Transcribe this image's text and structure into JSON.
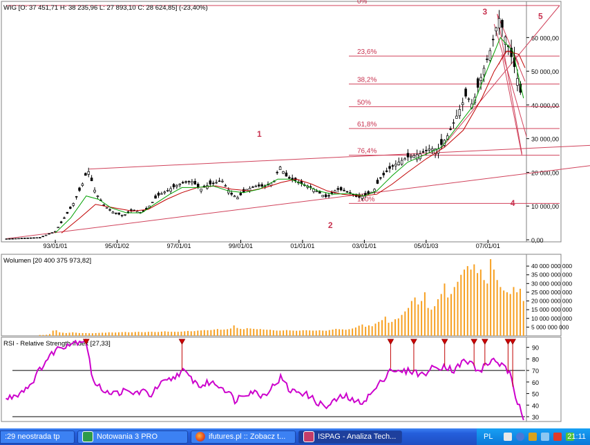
{
  "chart_data": [
    {
      "type": "candlestick",
      "title": "WIG [O: 37 451,71  H: 38 235,96  L: 27 893,10  C: 28 624,85] (-23,40%)",
      "x_ticks": [
        "93/01/01",
        "95/01/02",
        "97/01/01",
        "99/01/01",
        "01/01/01",
        "03/01/01",
        "05/01/03",
        "07/01/01"
      ],
      "x_range": [
        1991.3,
        2008.2
      ],
      "y_ticks": [
        "0,00",
        "10 000,00",
        "20 000,00",
        "30 000,00",
        "40 000,00",
        "50 000,00",
        "60 000,00"
      ],
      "y_range": [
        0,
        69500
      ],
      "series_price": [
        [
          1991.4,
          300
        ],
        [
          1992.5,
          700
        ],
        [
          1993.0,
          2500
        ],
        [
          1993.3,
          6500
        ],
        [
          1993.6,
          11000
        ],
        [
          1993.9,
          17000
        ],
        [
          1994.05,
          21000
        ],
        [
          1994.3,
          14000
        ],
        [
          1994.6,
          10000
        ],
        [
          1994.9,
          8000
        ],
        [
          1995.2,
          7200
        ],
        [
          1995.5,
          8800
        ],
        [
          1995.8,
          8000
        ],
        [
          1996.0,
          9500
        ],
        [
          1996.3,
          13000
        ],
        [
          1996.7,
          15000
        ],
        [
          1997.0,
          16500
        ],
        [
          1997.4,
          17500
        ],
        [
          1997.7,
          15000
        ],
        [
          1998.0,
          16500
        ],
        [
          1998.4,
          17500
        ],
        [
          1998.7,
          13500
        ],
        [
          1998.9,
          12500
        ],
        [
          1999.2,
          15000
        ],
        [
          1999.5,
          16000
        ],
        [
          1999.8,
          15800
        ],
        [
          2000.1,
          17500
        ],
        [
          2000.25,
          22000
        ],
        [
          2000.5,
          18500
        ],
        [
          2000.8,
          17500
        ],
        [
          2001.0,
          16500
        ],
        [
          2001.3,
          15500
        ],
        [
          2001.6,
          13500
        ],
        [
          2001.8,
          12500
        ],
        [
          2002.1,
          15000
        ],
        [
          2002.4,
          14500
        ],
        [
          2002.8,
          12500
        ],
        [
          2003.1,
          13500
        ],
        [
          2003.3,
          14500
        ],
        [
          2003.5,
          18000
        ],
        [
          2003.8,
          21000
        ],
        [
          2004.1,
          23000
        ],
        [
          2004.4,
          24500
        ],
        [
          2004.8,
          25500
        ],
        [
          2005.1,
          27000
        ],
        [
          2005.4,
          27000
        ],
        [
          2005.7,
          31000
        ],
        [
          2006.0,
          37000
        ],
        [
          2006.3,
          43000
        ],
        [
          2006.5,
          40000
        ],
        [
          2006.8,
          49000
        ],
        [
          2007.1,
          57000
        ],
        [
          2007.35,
          66000
        ],
        [
          2007.5,
          62000
        ],
        [
          2007.7,
          56000
        ],
        [
          2007.9,
          50000
        ],
        [
          2008.05,
          44000
        ],
        [
          2008.15,
          28624
        ]
      ],
      "series_ma_green": [
        [
          1993.0,
          2000
        ],
        [
          1993.5,
          6500
        ],
        [
          1994.0,
          13000
        ],
        [
          1994.4,
          12000
        ],
        [
          1994.8,
          9500
        ],
        [
          1995.3,
          8000
        ],
        [
          1995.8,
          8000
        ],
        [
          1996.2,
          10500
        ],
        [
          1996.7,
          13500
        ],
        [
          1997.1,
          15500
        ],
        [
          1997.6,
          15500
        ],
        [
          1998.1,
          16000
        ],
        [
          1998.6,
          14500
        ],
        [
          1999.1,
          14000
        ],
        [
          1999.6,
          15000
        ],
        [
          2000.2,
          18000
        ],
        [
          2000.6,
          18000
        ],
        [
          2001.0,
          16500
        ],
        [
          2001.5,
          14500
        ],
        [
          2002.0,
          13500
        ],
        [
          2002.5,
          13800
        ],
        [
          2003.0,
          13000
        ],
        [
          2003.4,
          14500
        ],
        [
          2003.9,
          19000
        ],
        [
          2004.4,
          23000
        ],
        [
          2004.9,
          25000
        ],
        [
          2005.5,
          27500
        ],
        [
          2006.0,
          33500
        ],
        [
          2006.5,
          39500
        ],
        [
          2007.0,
          51000
        ],
        [
          2007.4,
          60000
        ],
        [
          2007.8,
          56000
        ],
        [
          2008.15,
          42000
        ]
      ],
      "series_ma_red": [
        [
          1993.2,
          2000
        ],
        [
          1993.8,
          6500
        ],
        [
          1994.3,
          10500
        ],
        [
          1994.9,
          9500
        ],
        [
          1995.5,
          8500
        ],
        [
          1996.0,
          9000
        ],
        [
          1996.6,
          12000
        ],
        [
          1997.1,
          14000
        ],
        [
          1997.6,
          15500
        ],
        [
          1998.2,
          16000
        ],
        [
          1998.7,
          15000
        ],
        [
          1999.3,
          14500
        ],
        [
          1999.8,
          15500
        ],
        [
          2000.3,
          17000
        ],
        [
          2000.8,
          18000
        ],
        [
          2001.3,
          16500
        ],
        [
          2001.8,
          14500
        ],
        [
          2002.3,
          13500
        ],
        [
          2002.9,
          13000
        ],
        [
          2003.4,
          13500
        ],
        [
          2003.9,
          16500
        ],
        [
          2004.4,
          20000
        ],
        [
          2005.0,
          24000
        ],
        [
          2005.6,
          27500
        ],
        [
          2006.2,
          32500
        ],
        [
          2006.8,
          42000
        ],
        [
          2007.2,
          50000
        ],
        [
          2007.6,
          56000
        ],
        [
          2008.0,
          55000
        ],
        [
          2008.2,
          51000
        ]
      ],
      "fibonacci_levels": [
        "0%",
        "23,6%",
        "38,2%",
        "50%",
        "61,8%",
        "76,4%",
        "100%"
      ],
      "fibonacci_values": [
        69500,
        54500,
        46200,
        39500,
        33000,
        25100,
        10800
      ],
      "wave_labels": [
        "1",
        "2",
        "3",
        "4",
        "5"
      ],
      "colors": {
        "price": "#000000",
        "ma_green": "#00a000",
        "ma_red": "#c00000",
        "lines": "#d0415a",
        "labels": "#c8324f"
      }
    },
    {
      "type": "bar",
      "title": "Wolumen [20 400 375 973,82]",
      "y_ticks": [
        "5 000 000 000",
        "10 000 000 000",
        "15 000 000 000",
        "20 000 000 000",
        "25 000 000 000",
        "30 000 000 000",
        "35 000 000 000",
        "40 000 000 000"
      ],
      "y_range": [
        0,
        44000000000
      ],
      "values_bn": [
        0.5,
        0.5,
        0.6,
        1.0,
        3.0,
        3.2,
        2.0,
        1.8,
        1.6,
        1.8,
        2.0,
        1.8,
        1.6,
        1.6,
        1.6,
        1.5,
        1.5,
        1.6,
        1.7,
        1.8,
        1.8,
        2.0,
        1.9,
        1.9,
        2.0,
        2.1,
        2.2,
        2.0,
        2.0,
        2.2,
        2.3,
        2.1,
        2.1,
        2.3,
        2.3,
        2.2,
        2.2,
        2.4,
        2.6,
        2.4,
        2.3,
        2.3,
        2.3,
        2.4,
        2.6,
        2.8,
        2.6,
        2.7,
        3.0,
        3.1,
        3.3,
        3.2,
        3.3,
        3.6,
        3.9,
        3.5,
        3.6,
        3.8,
        4.2,
        6.0,
        4.5,
        4.0,
        3.8,
        4.4,
        4.2,
        4.0,
        3.8,
        3.9,
        3.6,
        3.5,
        3.5,
        3.2,
        3.0,
        3.0,
        3.1,
        3.3,
        3.1,
        3.0,
        2.9,
        3.0,
        3.2,
        3.2,
        3.1,
        3.0,
        3.0,
        3.2,
        3.0,
        2.9,
        3.3,
        3.6,
        4.0,
        3.8,
        3.7,
        3.5,
        3.8,
        4.2,
        4.8,
        5.8,
        6.5,
        5.2,
        6.0,
        5.5,
        7.0,
        8.0,
        9.0,
        11.0,
        7.5,
        8.0,
        9.5,
        10.0,
        12.0,
        14.0,
        16.0,
        20.0,
        22.0,
        18.0,
        20.0,
        25.0,
        16.0,
        15.0,
        17.0,
        21.0,
        24.0,
        30.0,
        22.0,
        24.0,
        28.0,
        31.0,
        35.0,
        38.0,
        40.0,
        38.0,
        41.0,
        36.0,
        38.0,
        32.0,
        30.0,
        44.0,
        38.0,
        32.0,
        28.0,
        26.0,
        25.0,
        24.0,
        28.0,
        25.0,
        27.0,
        20.0
      ],
      "color": "#f7a021"
    },
    {
      "type": "line",
      "title": "RSI - Relative Strength Index [27,33]",
      "y_ticks": [
        "30",
        "40",
        "50",
        "60",
        "70",
        "80",
        "90"
      ],
      "y_range": [
        27,
        97
      ],
      "reference_levels": [
        70,
        30
      ],
      "series_rsi": [
        [
          1991.4,
          45
        ],
        [
          1991.8,
          50
        ],
        [
          1992.2,
          58
        ],
        [
          1992.6,
          75
        ],
        [
          1993.0,
          88
        ],
        [
          1993.4,
          93
        ],
        [
          1993.7,
          95
        ],
        [
          1994.0,
          97
        ],
        [
          1994.15,
          70
        ],
        [
          1994.3,
          57
        ],
        [
          1994.6,
          53
        ],
        [
          1994.9,
          50
        ],
        [
          1995.2,
          52
        ],
        [
          1995.5,
          50
        ],
        [
          1995.8,
          52
        ],
        [
          1996.1,
          49
        ],
        [
          1996.4,
          58
        ],
        [
          1996.8,
          63
        ],
        [
          1997.1,
          70
        ],
        [
          1997.4,
          63
        ],
        [
          1997.7,
          56
        ],
        [
          1998.0,
          60
        ],
        [
          1998.3,
          57
        ],
        [
          1998.6,
          52
        ],
        [
          1998.8,
          44
        ],
        [
          1999.1,
          50
        ],
        [
          1999.4,
          52
        ],
        [
          1999.7,
          48
        ],
        [
          2000.0,
          55
        ],
        [
          2000.3,
          64
        ],
        [
          2000.6,
          52
        ],
        [
          2000.9,
          52
        ],
        [
          2001.2,
          48
        ],
        [
          2001.5,
          42
        ],
        [
          2001.8,
          38
        ],
        [
          2002.1,
          45
        ],
        [
          2002.4,
          48
        ],
        [
          2002.7,
          42
        ],
        [
          2003.0,
          44
        ],
        [
          2003.3,
          52
        ],
        [
          2003.6,
          62
        ],
        [
          2003.85,
          72
        ],
        [
          2004.1,
          68
        ],
        [
          2004.5,
          70
        ],
        [
          2004.9,
          66
        ],
        [
          2005.2,
          72
        ],
        [
          2005.6,
          74
        ],
        [
          2005.9,
          70
        ],
        [
          2006.2,
          78
        ],
        [
          2006.5,
          76
        ],
        [
          2006.7,
          68
        ],
        [
          2006.9,
          74
        ],
        [
          2007.2,
          80
        ],
        [
          2007.45,
          74
        ],
        [
          2007.7,
          68
        ],
        [
          2007.9,
          44
        ],
        [
          2008.05,
          40
        ],
        [
          2008.15,
          27
        ]
      ],
      "signals": [
        1994.0,
        1997.1,
        2003.85,
        2004.6,
        2005.6,
        2006.55,
        2006.9,
        2007.65,
        2007.8
      ],
      "color": "#cc00cc"
    }
  ],
  "taskbar": {
    "items": [
      ":29 neostrada tp",
      "Notowania 3 PRO",
      "ifutures.pl :: Zobacz t...",
      "ISPAG - Analiza Tech..."
    ],
    "tray": {
      "lang": "PL",
      "clock": "21:11"
    }
  }
}
